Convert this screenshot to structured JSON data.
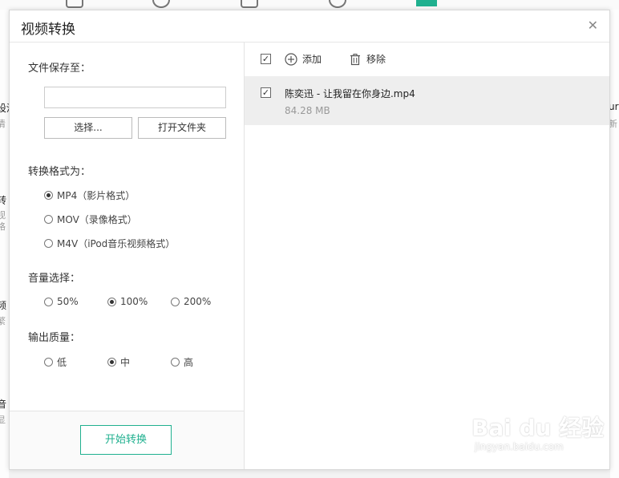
{
  "background": {
    "left_fragments": [
      {
        "text": "设清",
        "sub": false
      },
      {
        "text": "清",
        "sub": true
      },
      {
        "text": "转",
        "sub": false
      },
      {
        "text": "视",
        "sub": true
      },
      {
        "text": "格",
        "sub": true
      },
      {
        "text": "频",
        "sub": false
      },
      {
        "text": "繁",
        "sub": true
      },
      {
        "text": "音",
        "sub": false
      },
      {
        "text": "显",
        "sub": true
      }
    ],
    "right_fragments": [
      {
        "text": "ur",
        "sub": false
      },
      {
        "text": "新",
        "sub": true
      }
    ],
    "accent": "#20b08f"
  },
  "dialog": {
    "title": "视频转换",
    "close_icon": "close-icon",
    "left": {
      "save_to_label": "文件保存至：",
      "path_value": "",
      "choose_button": "选择...",
      "open_folder_button": "打开文件夹",
      "format_label": "转换格式为：",
      "formats": [
        {
          "label": "MP4（影片格式）",
          "checked": true
        },
        {
          "label": "MOV（录像格式）",
          "checked": false
        },
        {
          "label": "M4V（iPod音乐视频格式）",
          "checked": false
        }
      ],
      "volume_label": "音量选择：",
      "volumes": [
        {
          "label": "50%",
          "checked": false
        },
        {
          "label": "100%",
          "checked": true
        },
        {
          "label": "200%",
          "checked": false
        }
      ],
      "quality_label": "输出质量：",
      "qualities": [
        {
          "label": "低",
          "checked": false
        },
        {
          "label": "中",
          "checked": true
        },
        {
          "label": "高",
          "checked": false
        }
      ],
      "start_button": "开始转换"
    },
    "right": {
      "select_all_checked": true,
      "add_label": "添加",
      "remove_label": "移除",
      "files": [
        {
          "name": "陈奕迅 - 让我留在你身边.mp4",
          "size": "84.28 MB",
          "checked": true
        }
      ]
    }
  },
  "watermark": {
    "main": "Bai du 经验",
    "sub": "jingyan.baidu.com"
  }
}
